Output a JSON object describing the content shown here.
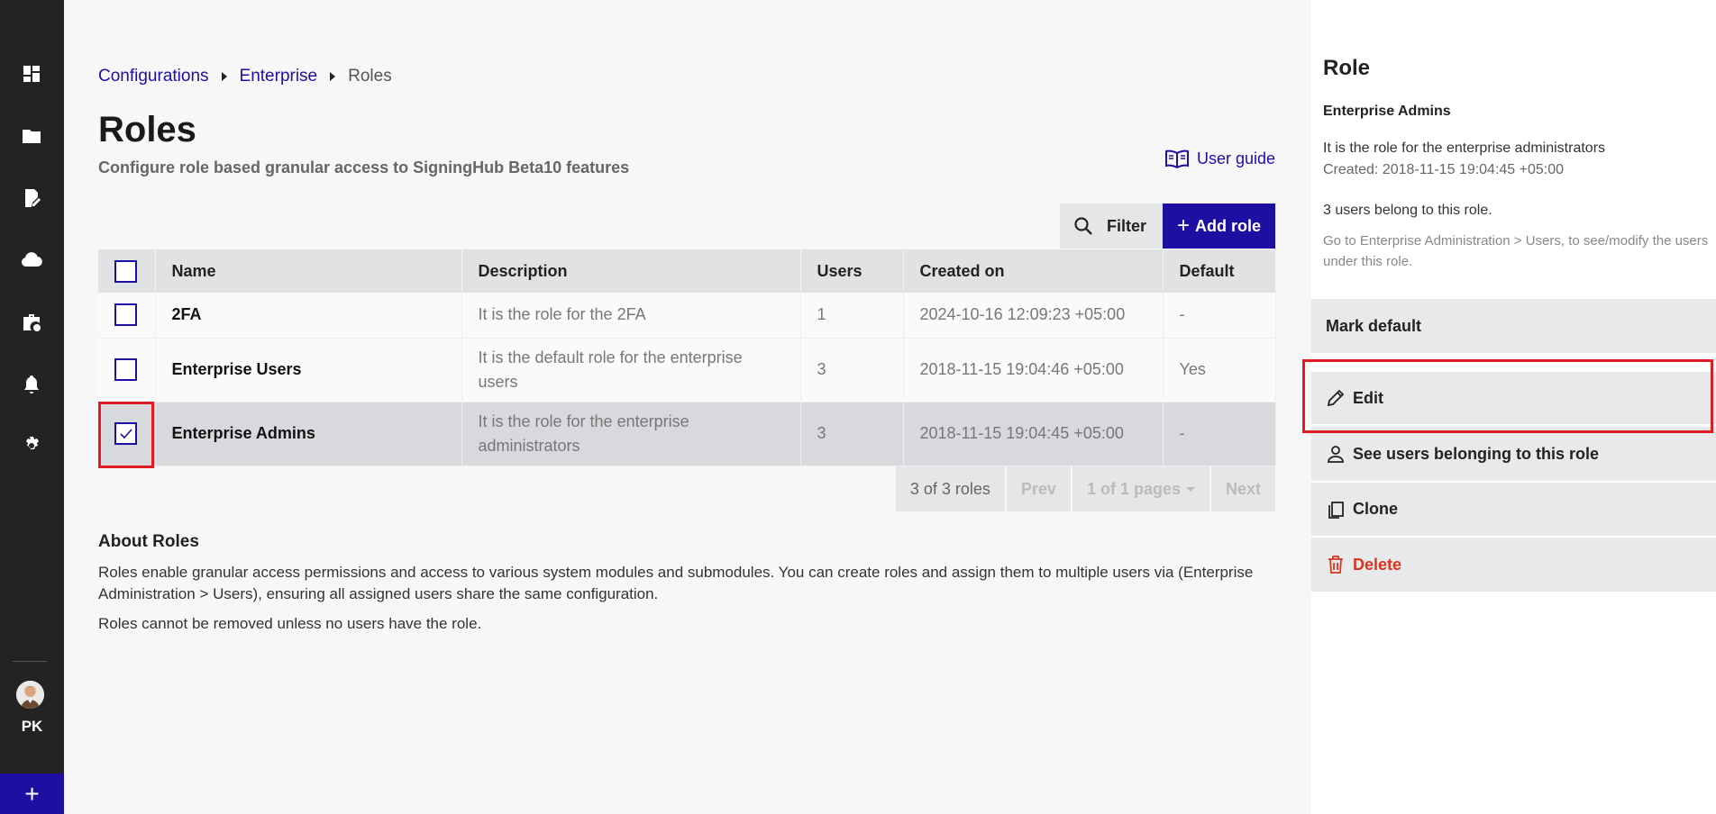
{
  "breadcrumb": {
    "item1": "Configurations",
    "item2": "Enterprise",
    "current": "Roles"
  },
  "page": {
    "title": "Roles",
    "subtitle": "Configure role based granular access to SigningHub Beta10 features",
    "user_guide": "User guide"
  },
  "toolbar": {
    "filter_label": "Filter",
    "add_label": "Add role"
  },
  "table": {
    "headers": {
      "name": "Name",
      "description": "Description",
      "users": "Users",
      "created_on": "Created on",
      "default": "Default"
    },
    "rows": [
      {
        "name": "2FA",
        "description": "It is the role for the 2FA",
        "users": "1",
        "created_on": "2024-10-16 12:09:23 +05:00",
        "default": "-"
      },
      {
        "name": "Enterprise Users",
        "description": "It is the default role for the enterprise users",
        "users": "3",
        "created_on": "2018-11-15 19:04:46 +05:00",
        "default": "Yes"
      },
      {
        "name": "Enterprise Admins",
        "description": "It is the role for the enterprise administrators",
        "users": "3",
        "created_on": "2018-11-15 19:04:45 +05:00",
        "default": "-"
      }
    ]
  },
  "pager": {
    "count": "3 of 3 roles",
    "prev": "Prev",
    "pages": "1 of 1 pages",
    "next": "Next"
  },
  "about": {
    "title": "About Roles",
    "text1": "Roles enable granular access permissions and access to various system modules and submodules. You can create roles and assign them to multiple users via (Enterprise Administration > Users), ensuring all assigned users share the same configuration.",
    "text2": "Roles cannot be removed unless no users have the role."
  },
  "rail": {
    "initials": "PK"
  },
  "panel": {
    "title": "Role",
    "role_name": "Enterprise Admins",
    "description": "It is the role for the enterprise administrators",
    "created": "Created: 2018-11-15 19:04:45 +05:00",
    "users_count": "3 users belong to this role.",
    "hint": "Go to Enterprise Administration > Users, to see/modify the users under this role.",
    "actions": {
      "mark_default": "Mark default",
      "edit": "Edit",
      "see_users": "See users belonging to this role",
      "clone": "Clone",
      "delete": "Delete"
    }
  },
  "colors": {
    "accent": "#1e0fa3",
    "danger": "#d9361f",
    "highlight": "#e01b24"
  }
}
